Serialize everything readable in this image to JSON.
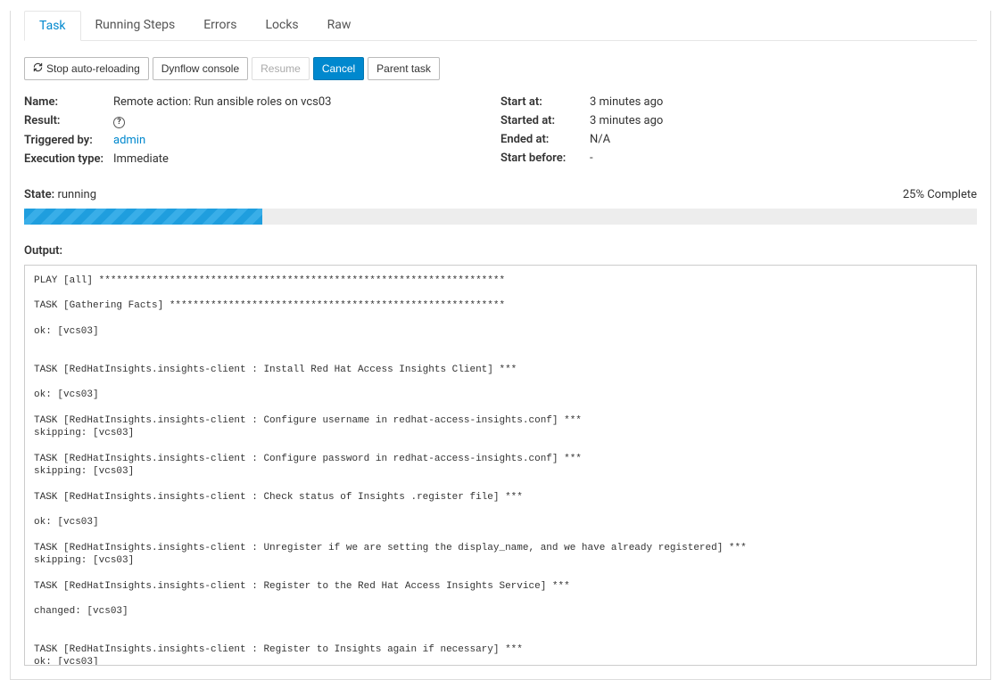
{
  "tabs": {
    "task": "Task",
    "running_steps": "Running Steps",
    "errors": "Errors",
    "locks": "Locks",
    "raw": "Raw"
  },
  "toolbar": {
    "stop_auto": "Stop auto-reloading",
    "dynflow": "Dynflow console",
    "resume": "Resume",
    "cancel": "Cancel",
    "parent": "Parent task"
  },
  "info_labels": {
    "name": "Name:",
    "result": "Result:",
    "triggered_by": "Triggered by:",
    "execution_type": "Execution type:",
    "start_at": "Start at:",
    "started_at": "Started at:",
    "ended_at": "Ended at:",
    "start_before": "Start before:"
  },
  "info_values": {
    "name": "Remote action: Run ansible roles on vcs03",
    "triggered_by": "admin",
    "execution_type": "Immediate",
    "start_at": "3 minutes ago",
    "started_at": "3 minutes ago",
    "ended_at": "N/A",
    "start_before": "-"
  },
  "state": {
    "label": "State:",
    "value": "running",
    "complete_text": "25% Complete",
    "percent": 25
  },
  "output": {
    "label": "Output:",
    "text": "PLAY [all] *********************************************************************\n\nTASK [Gathering Facts] *********************************************************\n\nok: [vcs03]\n\n\nTASK [RedHatInsights.insights-client : Install Red Hat Access Insights Client] ***\n\nok: [vcs03]\n\nTASK [RedHatInsights.insights-client : Configure username in redhat-access-insights.conf] ***\nskipping: [vcs03]\n\nTASK [RedHatInsights.insights-client : Configure password in redhat-access-insights.conf] ***\nskipping: [vcs03]\n\nTASK [RedHatInsights.insights-client : Check status of Insights .register file] ***\n\nok: [vcs03]\n\nTASK [RedHatInsights.insights-client : Unregister if we are setting the display_name, and we have already registered] ***\nskipping: [vcs03]\n\nTASK [RedHatInsights.insights-client : Register to the Red Hat Access Insights Service] ***\n\nchanged: [vcs03]\n\n\nTASK [RedHatInsights.insights-client : Register to Insights again if necessary] ***\nok: [vcs03]"
  }
}
